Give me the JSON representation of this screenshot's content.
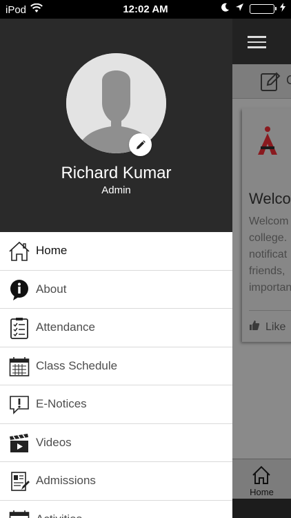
{
  "status_bar": {
    "carrier": "iPod",
    "time": "12:02 AM",
    "colors": {
      "battery": "#3ad353"
    }
  },
  "profile": {
    "name": "Richard Kumar",
    "role": "Admin"
  },
  "menu": {
    "items": [
      {
        "label": "Home",
        "icon": "home-icon"
      },
      {
        "label": "About",
        "icon": "info-icon"
      },
      {
        "label": "Attendance",
        "icon": "checklist-icon"
      },
      {
        "label": "Class Schedule",
        "icon": "calendar-icon"
      },
      {
        "label": "E-Notices",
        "icon": "notice-icon"
      },
      {
        "label": "Videos",
        "icon": "clapperboard-icon"
      },
      {
        "label": "Admissions",
        "icon": "admission-form-icon"
      },
      {
        "label": "Activities",
        "icon": "calendar-icon"
      }
    ]
  },
  "background": {
    "toolbar_text": "C",
    "welcome_title": "Welco",
    "body_lines": [
      "Welcom",
      "college.",
      "notificat",
      "friends,",
      "importan"
    ],
    "like_label": "Like",
    "tab_home": "Home"
  },
  "colors": {
    "drawer_header": "#2a2a2a",
    "topbar": "#222222",
    "accent_red": "#d6202a"
  }
}
